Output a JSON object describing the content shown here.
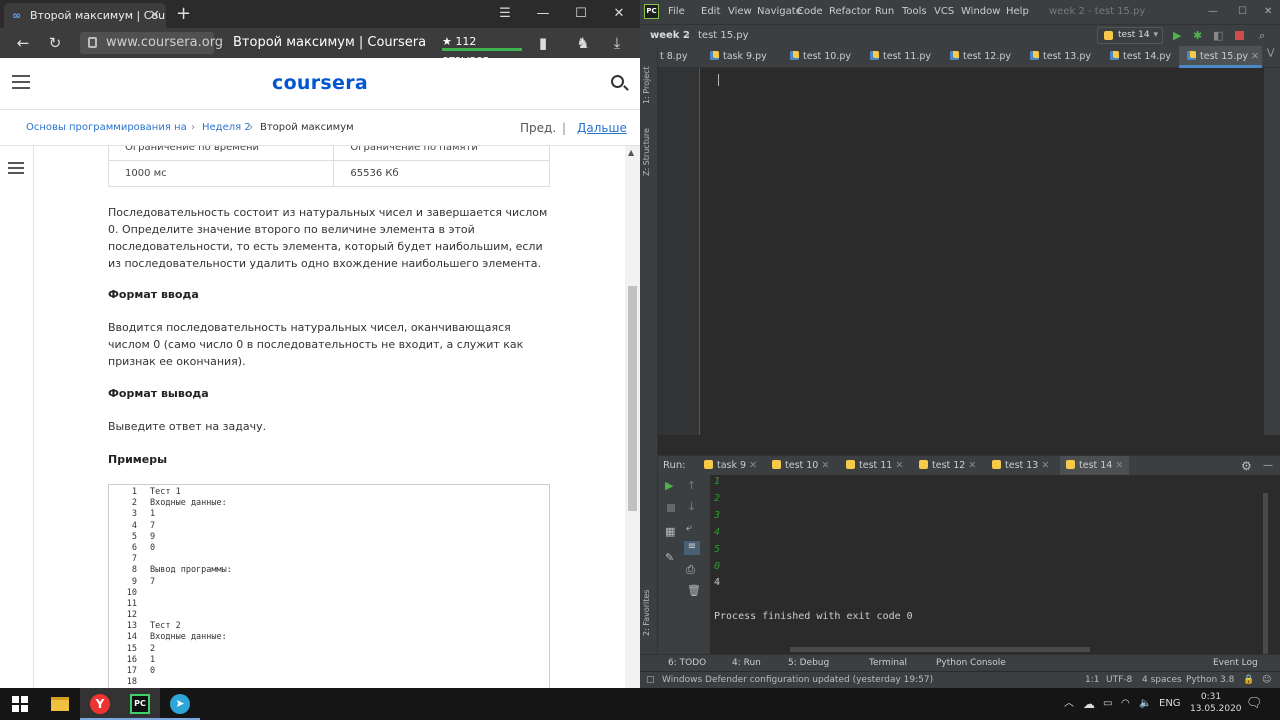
{
  "browser": {
    "tab_title": "Второй максимум | Cou",
    "tab_icon": "∞",
    "url": "www.coursera.org",
    "page_title": "Второй максимум | Coursera",
    "reviews": "★ 112 отзывов"
  },
  "coursera": {
    "logo": "coursera",
    "breadcrumbs": {
      "course": "Основы программирования на Pyth",
      "week": "Неделя 2",
      "current": "Второй максимум",
      "prev": "Пред.",
      "sep": "|",
      "next": "Дальше"
    },
    "limits": {
      "head_time": "Ограничение по времени",
      "head_memory": "Ограничение по памяти",
      "time": "1000 мс",
      "memory": "65536 Кб"
    },
    "statement": "Последовательность состоит из натуральных чисел и завершается числом 0. Определите значение второго по величине элемента в этой последовательности, то есть элемента, который будет наибольшим, если из последовательности удалить одно вхождение наибольшего элемента.",
    "input_heading": "Формат ввода",
    "input_text": "Вводится последовательность натуральных чисел, оканчивающаяся числом 0 (само число 0 в последовательность не входит, а служит как признак ее окончания).",
    "output_heading": "Формат вывода",
    "output_text": "Выведите ответ на задачу.",
    "examples_heading": "Примеры",
    "code_lines": [
      {
        "n": "1",
        "t": "Тест 1"
      },
      {
        "n": "2",
        "t": "Входные данные:"
      },
      {
        "n": "3",
        "t": "1"
      },
      {
        "n": "4",
        "t": "7"
      },
      {
        "n": "5",
        "t": "9"
      },
      {
        "n": "6",
        "t": "0"
      },
      {
        "n": "7",
        "t": ""
      },
      {
        "n": "8",
        "t": "Вывод программы:"
      },
      {
        "n": "9",
        "t": "7"
      },
      {
        "n": "10",
        "t": ""
      },
      {
        "n": "11",
        "t": ""
      },
      {
        "n": "12",
        "t": ""
      },
      {
        "n": "13",
        "t": "Тест 2"
      },
      {
        "n": "14",
        "t": "Входные данные:"
      },
      {
        "n": "15",
        "t": "2"
      },
      {
        "n": "16",
        "t": "1"
      },
      {
        "n": "17",
        "t": "0"
      },
      {
        "n": "18",
        "t": ""
      }
    ]
  },
  "ide": {
    "menu": [
      "File",
      "Edit",
      "View",
      "Navigate",
      "Code",
      "Refactor",
      "Run",
      "Tools",
      "VCS",
      "Window",
      "Help"
    ],
    "window_title": "week 2 - test 15.py",
    "nav_project": "week 2",
    "nav_file": "test 15.py",
    "run_config": "test 14",
    "editor_tabs": [
      "t 8.py",
      "task 9.py",
      "test 10.py",
      "test 11.py",
      "test 12.py",
      "test 13.py",
      "test 14.py",
      "test 15.py"
    ],
    "left_panels": [
      "1: Project",
      "Z: Structure",
      "2: Favorites"
    ],
    "run_label": "Run:",
    "run_tabs": [
      "task 9",
      "test 10",
      "test 11",
      "test 12",
      "test 13",
      "test 14"
    ],
    "console_input": [
      "1",
      "2",
      "3",
      "4",
      "5",
      "0"
    ],
    "console_output": "4",
    "console_finish": "Process finished with exit code 0",
    "bottom_tools": [
      "6: TODO",
      "4: Run",
      "5: Debug",
      "Terminal",
      "Python Console"
    ],
    "event_log": "Event Log",
    "status_message": "Windows Defender configuration updated (yesterday 19:57)",
    "status_right": [
      "1:1",
      "UTF-8",
      "4 spaces",
      "Python 3.8"
    ]
  },
  "taskbar": {
    "lang": "ENG",
    "time": "0:31",
    "date": "13.05.2020"
  },
  "colors": {
    "coursera_blue": "#0056d2",
    "link_blue": "#2a73cc",
    "ide_bg": "#2b2b2b",
    "console_green": "#2c9b2c"
  }
}
